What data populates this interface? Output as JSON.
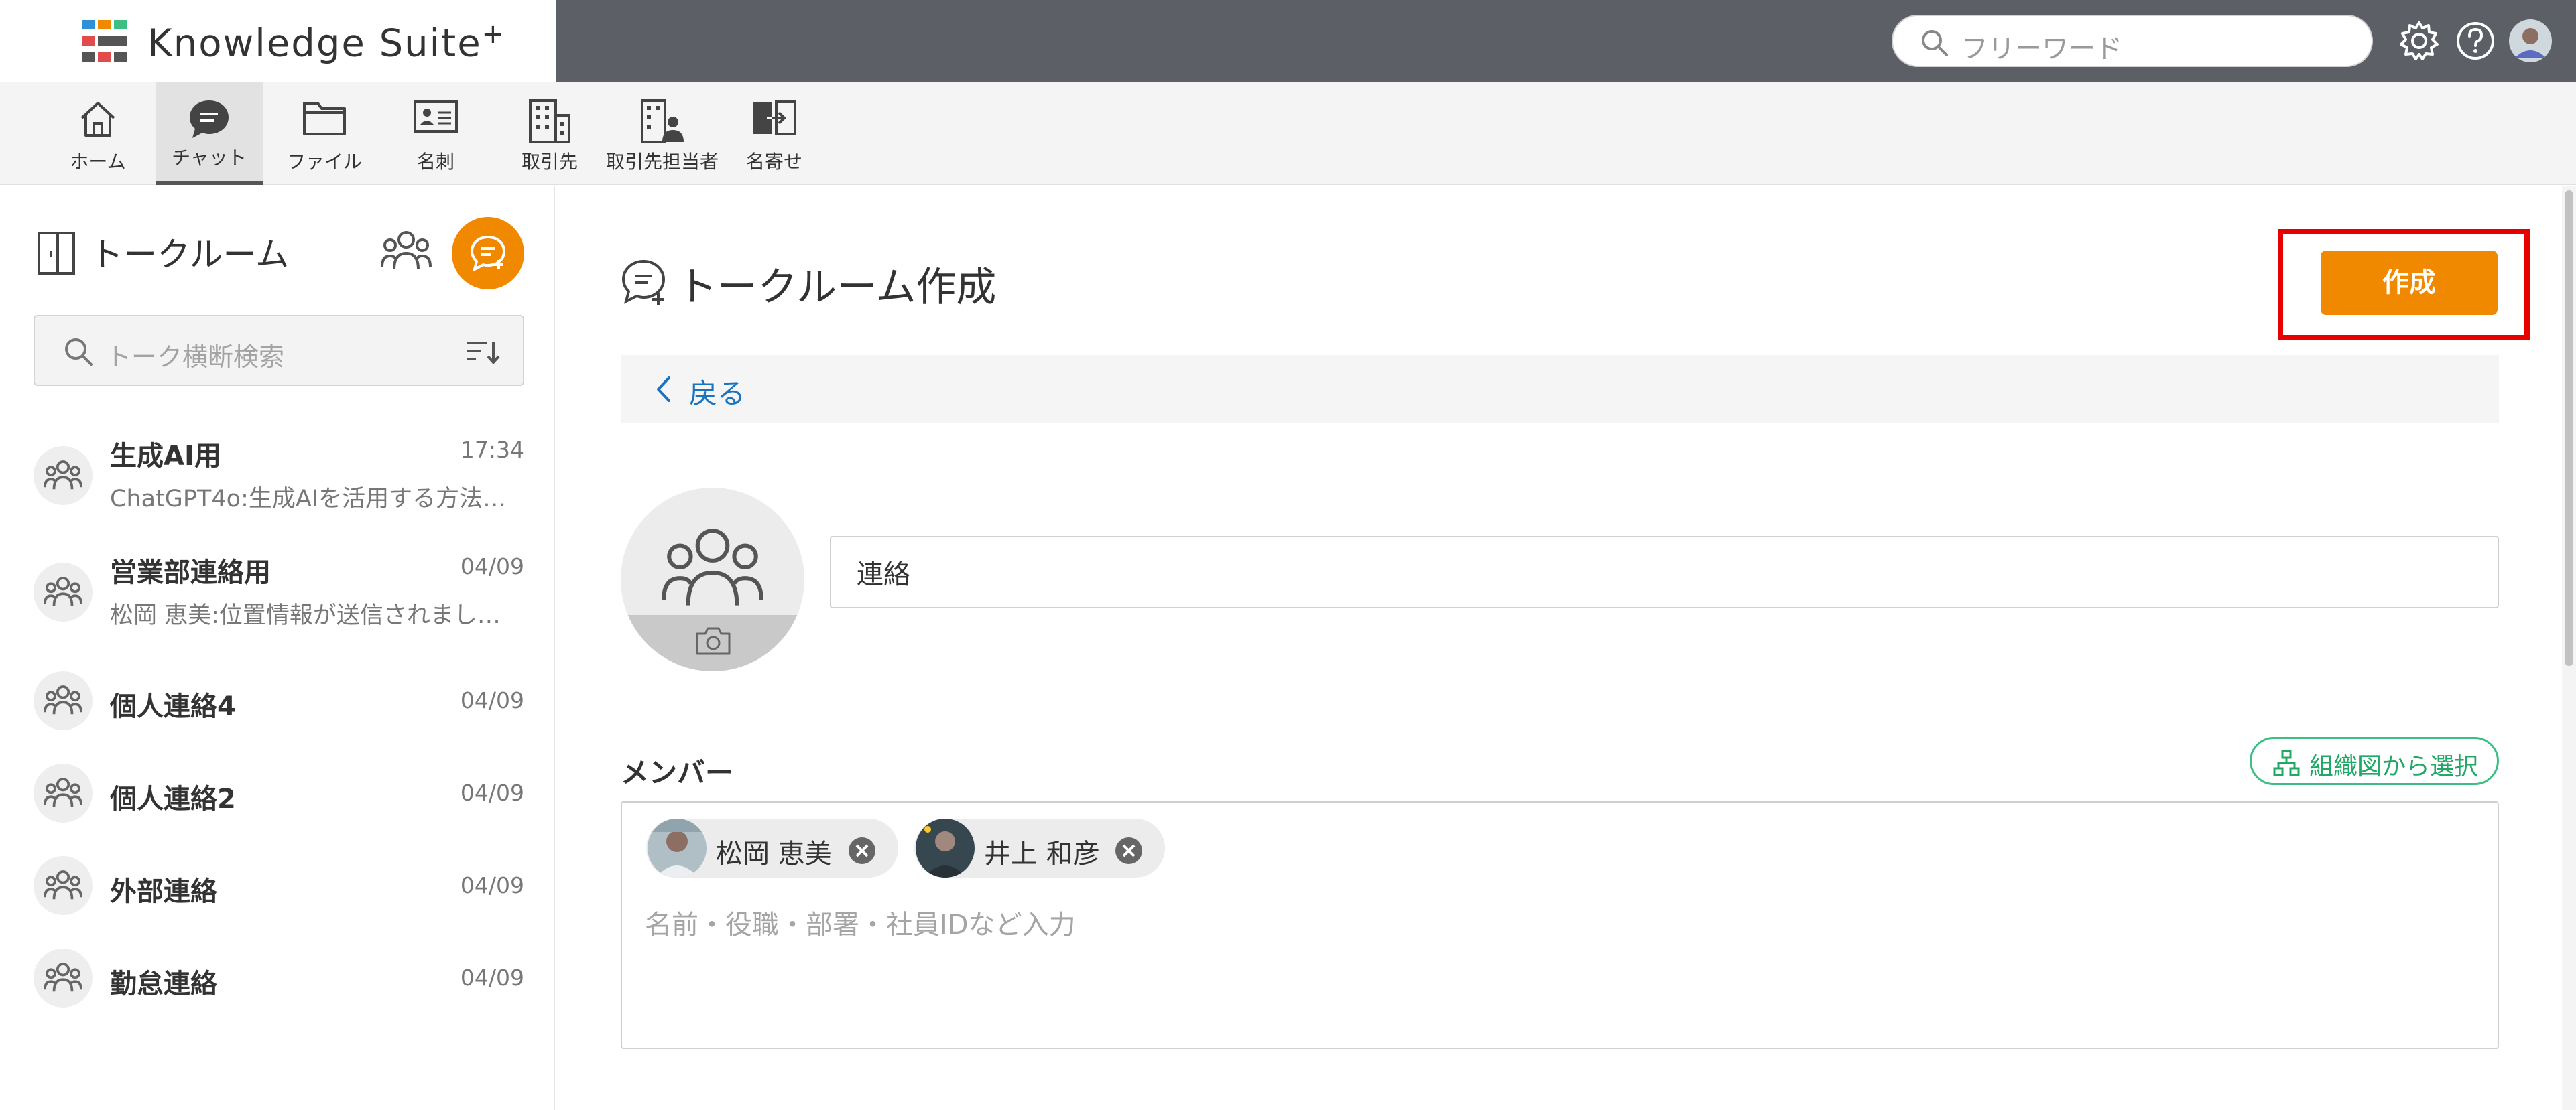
{
  "header": {
    "brand": "Knowledge Suite",
    "brand_sup": "+",
    "search_placeholder": "フリーワード",
    "icons": [
      "gear-icon",
      "help-icon",
      "avatar"
    ]
  },
  "nav": {
    "items": [
      {
        "label": "ホーム",
        "icon": "home-icon"
      },
      {
        "label": "チャット",
        "icon": "chat-icon",
        "active": true
      },
      {
        "label": "ファイル",
        "icon": "folder-icon"
      },
      {
        "label": "名刺",
        "icon": "business-card-icon"
      },
      {
        "label": "取引先",
        "icon": "building-icon"
      },
      {
        "label": "取引先担当者",
        "icon": "building-person-icon"
      },
      {
        "label": "名寄せ",
        "icon": "merge-icon"
      }
    ]
  },
  "sidebar": {
    "title": "トークルーム",
    "search_placeholder": "トーク横断検索",
    "rooms": [
      {
        "name": "生成AI用",
        "time": "17:34",
        "preview": "ChatGPT4o:生成AIを活用する方法…"
      },
      {
        "name": "営業部連絡用",
        "time": "04/09",
        "preview": "松岡 恵美:位置情報が送信されまし…"
      },
      {
        "name": "個人連絡4",
        "time": "04/09",
        "preview": ""
      },
      {
        "name": "個人連絡2",
        "time": "04/09",
        "preview": ""
      },
      {
        "name": "外部連絡",
        "time": "04/09",
        "preview": ""
      },
      {
        "name": "勤怠連絡",
        "time": "04/09",
        "preview": ""
      }
    ]
  },
  "main": {
    "title": "トークルーム作成",
    "create_label": "作成",
    "back_label": "戻る",
    "room_name_value": "連絡",
    "member_label": "メンバー",
    "org_select_label": "組織図から選択",
    "members": [
      {
        "name": "松岡 恵美"
      },
      {
        "name": "井上 和彦"
      }
    ],
    "member_placeholder": "名前・役職・部署・社員IDなど入力"
  },
  "colors": {
    "accent": "#f08800",
    "highlight": "#e60000",
    "link": "#1a73c0",
    "org_green": "#22a866",
    "header_bg": "#5d5f66"
  }
}
